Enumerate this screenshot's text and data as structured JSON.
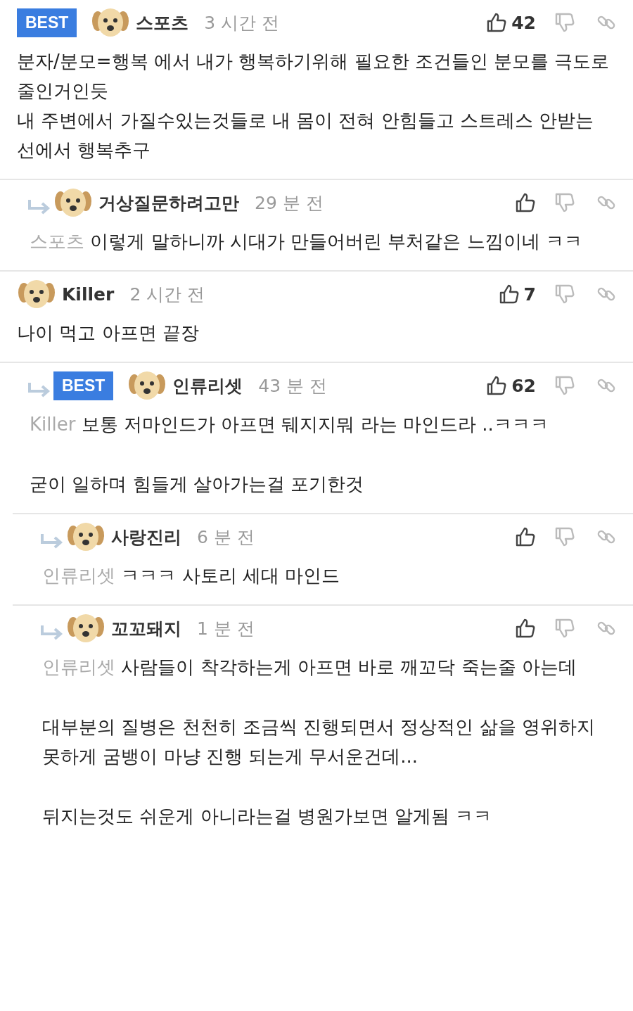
{
  "comments": [
    {
      "badge": "BEST",
      "user": "스포츠",
      "time": "3 시간 전",
      "likes": "42",
      "paragraphs": [
        [
          "분자/분모=행복 에서 내가 행복하기위해 필요한 조건들인 분모를 극도로 줄인거인듯",
          "내 주변에서 가질수있는것들로 내 몸이 전혀 안힘들고 스트레스 안받는 선에서 행복추구"
        ]
      ],
      "children": [
        {
          "user": "거상질문하려고만",
          "time": "29 분 전",
          "mention": "스포츠",
          "paragraphs": [
            [
              "이렇게 말하니까 시대가 만들어버린 부처같은 느낌이네 ㅋㅋ"
            ]
          ]
        }
      ]
    },
    {
      "user": "Killer",
      "time": "2 시간 전",
      "likes": "7",
      "paragraphs": [
        [
          "나이 먹고 아프면 끝장"
        ]
      ],
      "children": [
        {
          "badge": "BEST",
          "user": "인류리셋",
          "time": "43 분 전",
          "likes": "62",
          "mention": "Killer",
          "paragraphs": [
            [
              "보통 저마인드가 아프면 뒈지지뭐 라는 마인드라 ..ㅋㅋㅋ"
            ],
            [
              "굳이 일하며 힘들게 살아가는걸 포기한것"
            ]
          ],
          "children": [
            {
              "user": "사랑진리",
              "time": "6 분 전",
              "mention": "인류리셋",
              "paragraphs": [
                [
                  "ㅋㅋㅋ 사토리 세대 마인드"
                ]
              ]
            },
            {
              "user": "꼬꼬돼지",
              "time": "1 분 전",
              "mention": "인류리셋",
              "paragraphs": [
                [
                  "사람들이 착각하는게 아프면 바로 깨꼬닥 죽는줄 아는데"
                ],
                [
                  "대부분의 질병은 천천히 조금씩 진행되면서 정상적인 삶을 영위하지 못하게 굼뱅이 마냥 진행 되는게 무서운건데..."
                ],
                [
                  "뒤지는것도 쉬운게 아니라는걸 병원가보면 알게됨 ㅋㅋ"
                ]
              ]
            }
          ]
        }
      ]
    }
  ]
}
